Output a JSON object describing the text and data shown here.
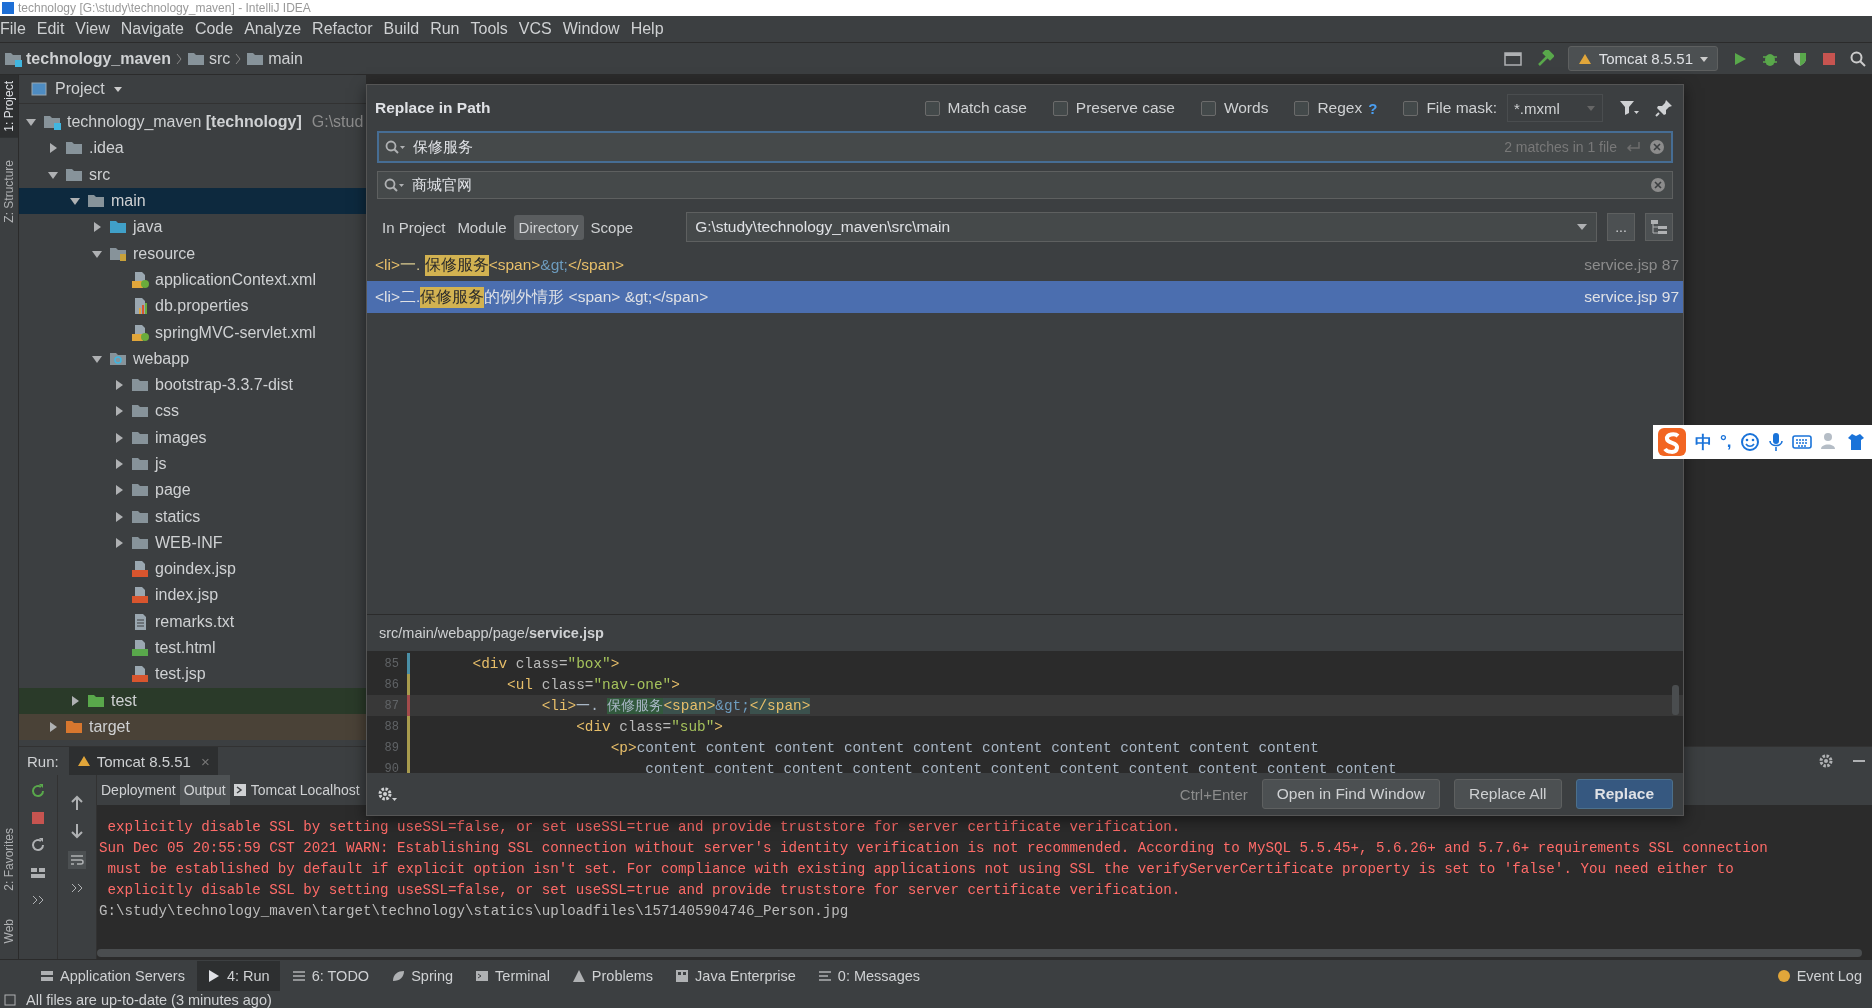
{
  "window": {
    "title": "technology [G:\\study\\technology_maven] - IntelliJ IDEA"
  },
  "menu": [
    "File",
    "Edit",
    "View",
    "Navigate",
    "Code",
    "Analyze",
    "Refactor",
    "Build",
    "Run",
    "Tools",
    "VCS",
    "Window",
    "Help"
  ],
  "breadcrumbs": [
    {
      "label": "technology_maven",
      "kind": "module"
    },
    {
      "label": "src",
      "kind": "folder"
    },
    {
      "label": "main",
      "kind": "folder"
    }
  ],
  "run_config": {
    "label": "Tomcat 8.5.51"
  },
  "side_tabs": [
    {
      "label": "1: Project",
      "selected": true
    },
    {
      "label": "Z: Structure",
      "selected": false
    }
  ],
  "side_tabs_bottom": [
    {
      "label": "2: Favorites",
      "selected": false
    },
    {
      "label": "Web",
      "selected": false
    }
  ],
  "project_panel": {
    "title": "Project",
    "tree": [
      {
        "label": "technology_maven **[technology]**",
        "path": "G:\\stud",
        "kind": "module",
        "expanded": true,
        "selected": false,
        "children": [
          {
            "label": ".idea",
            "kind": "folder",
            "expanded": false,
            "selected": false
          },
          {
            "label": "src",
            "kind": "folder",
            "expanded": true,
            "selected": false,
            "children": [
              {
                "label": "main",
                "kind": "folder",
                "expanded": true,
                "selected": true,
                "children": [
                  {
                    "label": "java",
                    "kind": "source-folder",
                    "expanded": false,
                    "selected": false
                  },
                  {
                    "label": "resource",
                    "kind": "resource-folder",
                    "expanded": true,
                    "selected": false,
                    "children": [
                      {
                        "label": "applicationContext.xml",
                        "kind": "xml",
                        "selected": false
                      },
                      {
                        "label": "db.properties",
                        "kind": "properties",
                        "selected": false
                      },
                      {
                        "label": "springMVC-servlet.xml",
                        "kind": "xml",
                        "selected": false
                      }
                    ]
                  },
                  {
                    "label": "webapp",
                    "kind": "web-folder",
                    "expanded": true,
                    "selected": false,
                    "children": [
                      {
                        "label": "bootstrap-3.3.7-dist",
                        "kind": "folder",
                        "expanded": false,
                        "selected": false
                      },
                      {
                        "label": "css",
                        "kind": "folder",
                        "expanded": false,
                        "selected": false
                      },
                      {
                        "label": "images",
                        "kind": "folder",
                        "expanded": false,
                        "selected": false
                      },
                      {
                        "label": "js",
                        "kind": "folder",
                        "expanded": false,
                        "selected": false
                      },
                      {
                        "label": "page",
                        "kind": "folder",
                        "expanded": false,
                        "selected": false
                      },
                      {
                        "label": "statics",
                        "kind": "folder",
                        "expanded": false,
                        "selected": false
                      },
                      {
                        "label": "WEB-INF",
                        "kind": "folder",
                        "expanded": false,
                        "selected": false
                      },
                      {
                        "label": "goindex.jsp",
                        "kind": "jsp",
                        "selected": false
                      },
                      {
                        "label": "index.jsp",
                        "kind": "jsp",
                        "selected": false
                      },
                      {
                        "label": "remarks.txt",
                        "kind": "text",
                        "selected": false
                      },
                      {
                        "label": "test.html",
                        "kind": "html",
                        "selected": false
                      },
                      {
                        "label": "test.jsp",
                        "kind": "jsp",
                        "selected": false
                      }
                    ]
                  }
                ]
              },
              {
                "label": "test",
                "kind": "test-folder",
                "expanded": false,
                "selected": false
              }
            ]
          },
          {
            "label": "target",
            "kind": "excluded-folder",
            "expanded": false,
            "selected": false
          }
        ]
      }
    ]
  },
  "replace_dialog": {
    "title": "Replace in Path",
    "options": [
      {
        "label": "Match case",
        "checked": false
      },
      {
        "label": "Preserve case",
        "checked": false
      },
      {
        "label": "Words",
        "checked": false
      },
      {
        "label": "Regex",
        "checked": false,
        "help": "?"
      },
      {
        "label": "File mask:",
        "checked": false
      }
    ],
    "file_mask": {
      "value": "*.mxml",
      "disabled": true
    },
    "search": {
      "value": "保修服务",
      "info": "2 matches in 1 file"
    },
    "replace": {
      "value": "商城官网"
    },
    "scopes": [
      {
        "label": "In Project",
        "selected": false
      },
      {
        "label": "Module",
        "selected": false
      },
      {
        "label": "Directory",
        "selected": true
      },
      {
        "label": "Scope",
        "selected": false
      }
    ],
    "directory": {
      "value": "G:\\study\\technology_maven\\src\\main",
      "browse": "..."
    },
    "results": [
      {
        "selected": false,
        "file": "service.jsp 87",
        "parts": [
          {
            "text": "<li>",
            "kind": "tag"
          },
          {
            "text": "一. ",
            "kind": "text"
          },
          {
            "text": "保修服务",
            "kind": "match"
          },
          {
            "text": "<span>",
            "kind": "tag"
          },
          {
            "text": "&gt;",
            "kind": "entity"
          },
          {
            "text": "</span>",
            "kind": "tag"
          }
        ]
      },
      {
        "selected": true,
        "file": "service.jsp 97",
        "parts": [
          {
            "text": "<li>",
            "kind": "tag"
          },
          {
            "text": "二.",
            "kind": "text"
          },
          {
            "text": "保修服务",
            "kind": "match"
          },
          {
            "text": "的例外情形 <span> &gt;</span>",
            "kind": "text"
          }
        ]
      }
    ],
    "preview": {
      "path": "src/main/webapp/page/**service.jsp**",
      "lines": [
        {
          "number": "85",
          "color": "#4a8fa6",
          "current": false,
          "parts": [
            {
              "text": "    <div",
              "kind": "tag"
            },
            {
              "text": " class=",
              "kind": "attr"
            },
            {
              "text": "\"box\"",
              "kind": "string"
            },
            {
              "text": ">",
              "kind": "tag"
            }
          ]
        },
        {
          "number": "86",
          "color": "#a89b4d",
          "current": false,
          "parts": [
            {
              "text": "        <ul",
              "kind": "tag"
            },
            {
              "text": " class=",
              "kind": "attr"
            },
            {
              "text": "\"nav-one\"",
              "kind": "string"
            },
            {
              "text": ">",
              "kind": "tag"
            }
          ]
        },
        {
          "number": "87",
          "color": "#a34b4b",
          "current": true,
          "parts": [
            {
              "text": "            <li>",
              "kind": "tag"
            },
            {
              "text": "一. ",
              "kind": "text"
            },
            {
              "text": "保修服务",
              "kind": "match"
            },
            {
              "text": "<span>",
              "kind": "tag-pair"
            },
            {
              "text": "&gt;",
              "kind": "entity"
            },
            {
              "text": "</span>",
              "kind": "tag-pair"
            }
          ]
        },
        {
          "number": "88",
          "color": "#a89b4d",
          "current": false,
          "parts": [
            {
              "text": "                <div",
              "kind": "tag"
            },
            {
              "text": " class=",
              "kind": "attr"
            },
            {
              "text": "\"sub\"",
              "kind": "string"
            },
            {
              "text": ">",
              "kind": "tag"
            }
          ]
        },
        {
          "number": "89",
          "color": "#a89b4d",
          "current": false,
          "parts": [
            {
              "text": "                    <p>",
              "kind": "tag"
            },
            {
              "text": "content content content content content content content content content content",
              "kind": "text"
            }
          ]
        },
        {
          "number": "90",
          "color": "#a89b4d",
          "current": false,
          "parts": [
            {
              "text": "                        content content content content content content content content content content content",
              "kind": "text"
            }
          ]
        }
      ]
    },
    "shortcut": "Ctrl+Enter",
    "buttons": [
      {
        "label": "Open in Find Window",
        "kind": "normal"
      },
      {
        "label": "Replace All",
        "kind": "normal"
      },
      {
        "label": "Replace",
        "kind": "primary"
      }
    ]
  },
  "run_panel": {
    "title": "Run:",
    "tabs": [
      {
        "label": "Tomcat 8.5.51",
        "selected": true,
        "close": "×"
      }
    ],
    "subtabs": [
      {
        "label": "Deployment",
        "selected": false
      },
      {
        "label": "Output",
        "selected": true
      },
      {
        "label": "Tomcat Localhost",
        "selected": false
      }
    ],
    "console": [
      {
        "kind": "error",
        "text": " explicitly disable SSL by setting useSSL=false, or set useSSL=true and provide truststore for server certificate verification."
      },
      {
        "kind": "error",
        "text": "Sun Dec 05 20:55:59 CST 2021 WARN: Establishing SSL connection without server's identity verification is not recommended. According to MySQL 5.5.45+, 5.6.26+ and 5.7.6+ requirements SSL connection"
      },
      {
        "kind": "error",
        "text": " must be established by default if explicit option isn't set. For compliance with existing applications not using SSL the verifyServerCertificate property is set to 'false'. You need either to"
      },
      {
        "kind": "error",
        "text": " explicitly disable SSL by setting useSSL=false, or set useSSL=true and provide truststore for server certificate verification."
      },
      {
        "kind": "info",
        "text": "G:\\study\\technology_maven\\target\\technology\\statics\\uploadfiles\\1571405904746_Person.jpg"
      }
    ]
  },
  "tool_tabs": [
    {
      "label": "Application Servers",
      "kind": "servers",
      "selected": false
    },
    {
      "label": "4: Run",
      "kind": "run",
      "selected": true
    },
    {
      "label": "6: TODO",
      "kind": "todo",
      "selected": false
    },
    {
      "label": "Spring",
      "kind": "spring",
      "selected": false
    },
    {
      "label": "Terminal",
      "kind": "terminal",
      "selected": false
    },
    {
      "label": "Problems",
      "kind": "problems",
      "selected": false
    },
    {
      "label": "Java Enterprise",
      "kind": "enterprise",
      "selected": false
    },
    {
      "label": "0: Messages",
      "kind": "messages",
      "selected": false
    }
  ],
  "event_log": {
    "label": "Event Log"
  },
  "status_bar": {
    "text": "All files are up-to-date (3 minutes ago)"
  },
  "ime_toolbar": {
    "labels": [
      "中",
      "°,"
    ]
  }
}
